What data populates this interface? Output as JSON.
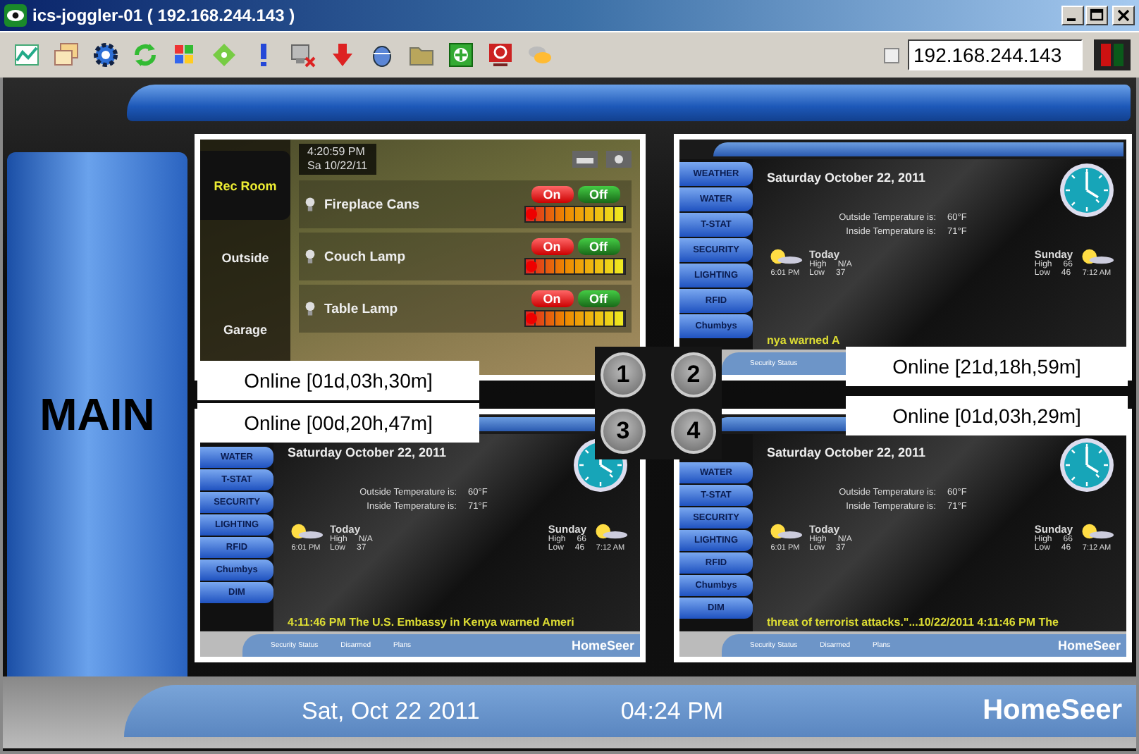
{
  "window": {
    "title": "ics-joggler-01 ( 192.168.244.143 )"
  },
  "toolbar": {
    "checkbox": {
      "checked": false
    },
    "address": "192.168.244.143"
  },
  "main_label": "MAIN",
  "panels": [
    {
      "kind": "lighting",
      "number": "1",
      "status": "Online [01d,03h,30m]",
      "time": "4:20:59 PM",
      "date": "Sa 10/22/11",
      "rooms": [
        {
          "label": "Rec Room",
          "selected": true
        },
        {
          "label": "Outside",
          "selected": false
        },
        {
          "label": "Garage",
          "selected": false
        }
      ],
      "devices": [
        {
          "name": "Fireplace Cans",
          "on_label": "On",
          "off_label": "Off",
          "level": 0.05
        },
        {
          "name": "Couch Lamp",
          "on_label": "On",
          "off_label": "Off",
          "level": 0.05
        },
        {
          "name": "Table Lamp",
          "on_label": "On",
          "off_label": "Off",
          "level": 0.05
        }
      ]
    },
    {
      "kind": "weather",
      "number": "2",
      "status": "Online [21d,18h,59m]",
      "nav": [
        "WEATHER",
        "WATER",
        "T-STAT",
        "SECURITY",
        "LIGHTING",
        "RFID",
        "Chumbys"
      ],
      "date": "Saturday October 22, 2011",
      "outside_label": "Outside Temperature is:",
      "outside_value": "60°F",
      "inside_label": "Inside Temperature is:",
      "inside_value": "71°F",
      "forecast": [
        {
          "day": "Today",
          "high_label": "High",
          "high": "N/A",
          "low_label": "Low",
          "low": "37",
          "time": "6:01 PM"
        },
        {
          "day": "Sunday",
          "high_label": "High",
          "high": "66",
          "low_label": "Low",
          "low": "46",
          "time": "7:12 AM"
        }
      ],
      "ticker": "nya warned A",
      "footer_items": [
        "Security Status"
      ]
    },
    {
      "kind": "weather",
      "number": "3",
      "status": "Online [00d,20h,47m]",
      "nav": [
        "WATER",
        "T-STAT",
        "SECURITY",
        "LIGHTING",
        "RFID",
        "Chumbys",
        "DIM"
      ],
      "date": "Saturday October 22, 2011",
      "outside_label": "Outside Temperature is:",
      "outside_value": "60°F",
      "inside_label": "Inside Temperature is:",
      "inside_value": "71°F",
      "forecast": [
        {
          "day": "Today",
          "high_label": "High",
          "high": "N/A",
          "low_label": "Low",
          "low": "37",
          "time": "6:01 PM"
        },
        {
          "day": "Sunday",
          "high_label": "High",
          "high": "66",
          "low_label": "Low",
          "low": "46",
          "time": "7:12 AM"
        }
      ],
      "ticker": "4:11:46 PM The U.S. Embassy in Kenya warned Ameri",
      "footer_items": [
        "Security Status",
        "Disarmed",
        "Plans"
      ],
      "logo": "HomeSeer"
    },
    {
      "kind": "weather",
      "number": "4",
      "status": "Online [01d,03h,29m]",
      "nav": [
        "WATER",
        "T-STAT",
        "SECURITY",
        "LIGHTING",
        "RFID",
        "Chumbys",
        "DIM"
      ],
      "date": "Saturday October 22, 2011",
      "outside_label": "Outside Temperature is:",
      "outside_value": "60°F",
      "inside_label": "Inside Temperature is:",
      "inside_value": "71°F",
      "forecast": [
        {
          "day": "Today",
          "high_label": "High",
          "high": "N/A",
          "low_label": "Low",
          "low": "37",
          "time": "6:01 PM"
        },
        {
          "day": "Sunday",
          "high_label": "High",
          "high": "66",
          "low_label": "Low",
          "low": "46",
          "time": "7:12 AM"
        }
      ],
      "ticker": "threat of terrorist attacks.\"...10/22/2011 4:11:46 PM The",
      "footer_items": [
        "Security Status",
        "Disarmed",
        "Plans"
      ],
      "logo": "HomeSeer"
    }
  ],
  "footer": {
    "date": "Sat, Oct 22 2011",
    "time": "04:24 PM",
    "logo": "HomeSeer"
  }
}
